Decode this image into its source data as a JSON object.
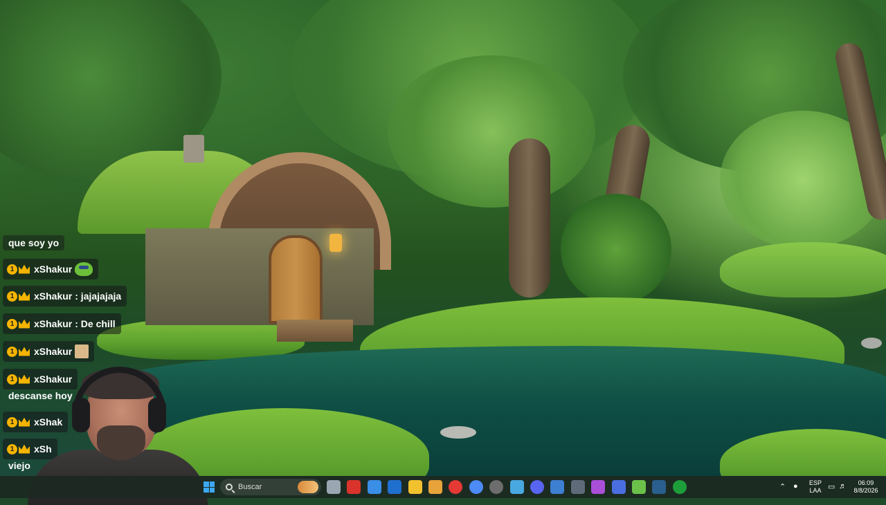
{
  "chat": {
    "partial_top": "que soy yo",
    "messages": [
      {
        "badge": "1",
        "user": "xShakur",
        "text": "",
        "emote": "pepe-frog-emote"
      },
      {
        "badge": "1",
        "user": "xShakur",
        "text": ": jajajajaja",
        "emote": ""
      },
      {
        "badge": "1",
        "user": "xShakur",
        "text": ": De chill",
        "emote": ""
      },
      {
        "badge": "1",
        "user": "xShakur",
        "text": "",
        "emote": "image-emote"
      },
      {
        "badge": "1",
        "user": "xShakur",
        "text": "",
        "emote": ""
      },
      {
        "badge": "1",
        "user": "xShak",
        "text": "",
        "emote": ""
      },
      {
        "badge": "1",
        "user": "xSh",
        "text": "",
        "emote": ""
      }
    ],
    "wrap_line_1": "descanse hoy",
    "wrap_line_2": "viejo"
  },
  "taskbar": {
    "search_placeholder": "Buscar",
    "pinned_apps": [
      {
        "name": "task-view-icon",
        "color": "#9aa6b2"
      },
      {
        "name": "app-red-icon",
        "color": "#d9332b"
      },
      {
        "name": "calendar-icon",
        "color": "#3a8ee6"
      },
      {
        "name": "outlook-icon",
        "color": "#1f6fcf"
      },
      {
        "name": "file-explorer-icon",
        "color": "#f2c12e"
      },
      {
        "name": "pdf-icon",
        "color": "#e8a33a"
      },
      {
        "name": "youtube-music-icon",
        "color": "#e53935"
      },
      {
        "name": "chrome-icon",
        "color": "#4c8bf5"
      },
      {
        "name": "obs-icon",
        "color": "#6d6d6d"
      },
      {
        "name": "notepad-icon",
        "color": "#49a8e0"
      },
      {
        "name": "discord-icon",
        "color": "#5865f2"
      },
      {
        "name": "photos-icon",
        "color": "#3d7fd1"
      },
      {
        "name": "calculator-icon",
        "color": "#5f6b78"
      },
      {
        "name": "podcast-icon",
        "color": "#a94fd8"
      },
      {
        "name": "app-diamond-icon",
        "color": "#4a6ee0"
      },
      {
        "name": "android-icon",
        "color": "#6cc04a"
      },
      {
        "name": "steam-icon",
        "color": "#2a5f8f"
      },
      {
        "name": "xbox-icon",
        "color": "#1d9e3a"
      }
    ],
    "language_top": "ESP",
    "language_bottom": "LAA",
    "time": "06:09",
    "date": "8/8/2026"
  }
}
